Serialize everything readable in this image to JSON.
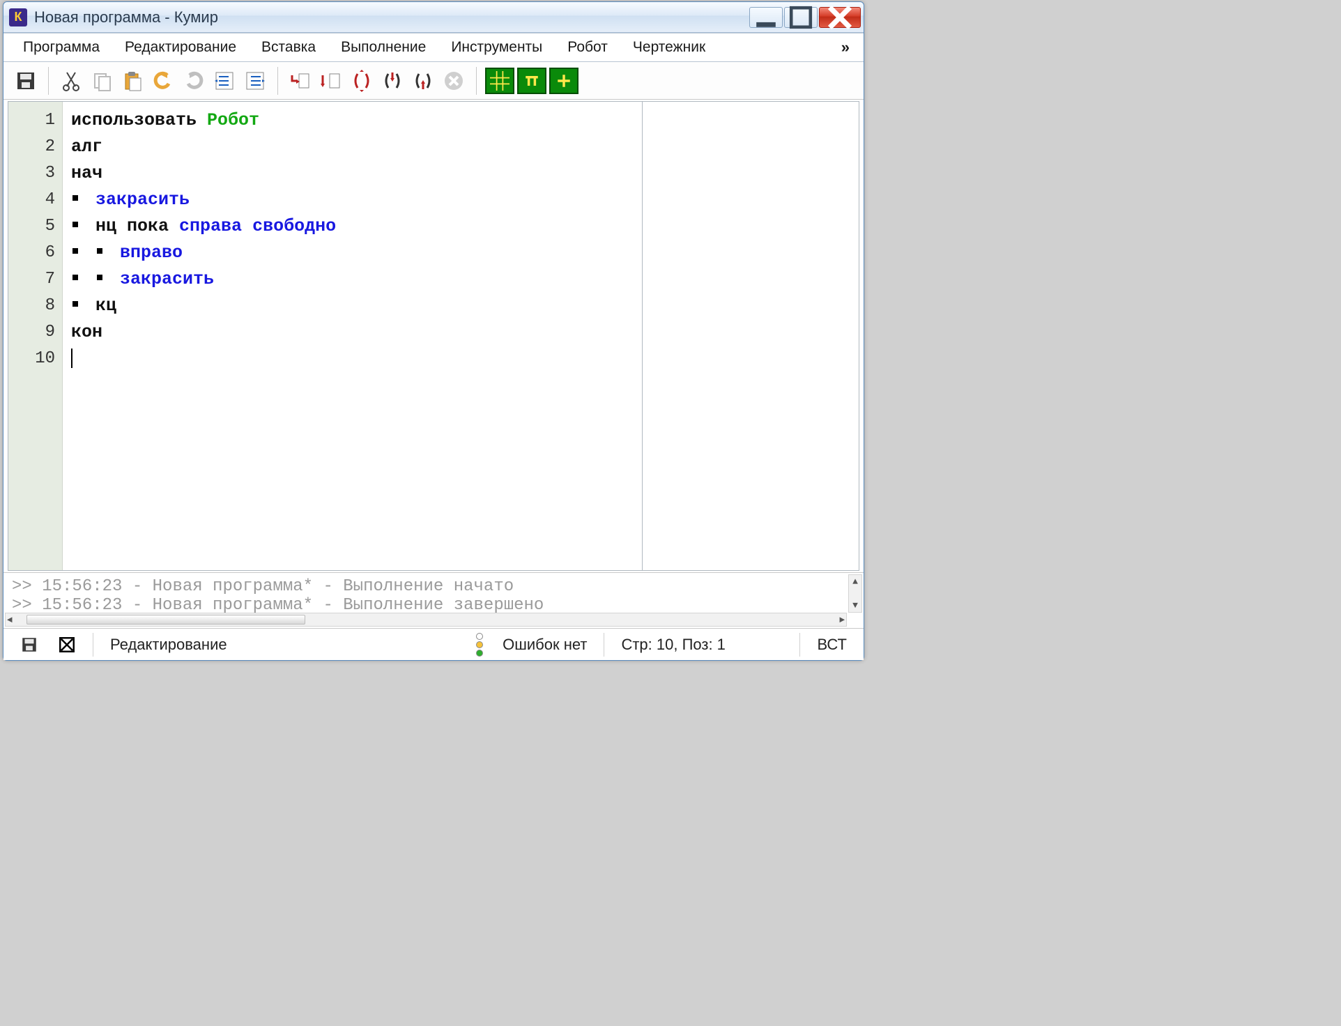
{
  "window": {
    "title": "Новая программа - Кумир",
    "icon_letter": "К"
  },
  "menu": {
    "items": [
      "Программа",
      "Редактирование",
      "Вставка",
      "Выполнение",
      "Инструменты",
      "Робот",
      "Чертежник"
    ],
    "overflow": "»"
  },
  "toolbar": {
    "icons": [
      "save-icon",
      "cut-icon",
      "copy-icon",
      "paste-icon",
      "undo-icon",
      "redo-icon",
      "indent-left-icon",
      "indent-right-icon",
      "step-into-icon",
      "step-over-icon",
      "run-icon",
      "run-to-cursor-icon",
      "go-back-icon",
      "stop-icon",
      "robot-grid-icon",
      "robot-pi-icon",
      "robot-plus-icon"
    ]
  },
  "editor": {
    "line_numbers": [
      "1",
      "2",
      "3",
      "4",
      "5",
      "6",
      "7",
      "8",
      "9",
      "10"
    ],
    "lines": [
      {
        "segments": [
          {
            "t": "использовать ",
            "c": "kw-black"
          },
          {
            "t": "Робот",
            "c": "kw-green"
          }
        ]
      },
      {
        "segments": [
          {
            "t": "алг",
            "c": "kw-black"
          }
        ]
      },
      {
        "segments": [
          {
            "t": "нач",
            "c": "kw-black"
          }
        ]
      },
      {
        "indent": 1,
        "segments": [
          {
            "t": "закрасить",
            "c": "kw-blue"
          }
        ]
      },
      {
        "indent": 1,
        "segments": [
          {
            "t": "нц пока ",
            "c": "kw-black"
          },
          {
            "t": "справа свободно",
            "c": "kw-blue"
          }
        ]
      },
      {
        "indent": 2,
        "segments": [
          {
            "t": "вправо",
            "c": "kw-blue"
          }
        ]
      },
      {
        "indent": 2,
        "segments": [
          {
            "t": "закрасить",
            "c": "kw-blue"
          }
        ]
      },
      {
        "indent": 1,
        "segments": [
          {
            "t": "кц",
            "c": "kw-black"
          }
        ]
      },
      {
        "segments": [
          {
            "t": "кон",
            "c": "kw-black"
          }
        ]
      },
      {
        "segments": [],
        "caret": true
      }
    ]
  },
  "log": {
    "lines": [
      ">> 15:56:23 - Новая программа* - Выполнение начато",
      ">> 15:56:23 - Новая программа* - Выполнение завершено"
    ]
  },
  "status": {
    "mode": "Редактирование",
    "errors": "Ошибок нет",
    "position": "Стр: 10, Поз: 1",
    "insert": "ВСТ"
  }
}
